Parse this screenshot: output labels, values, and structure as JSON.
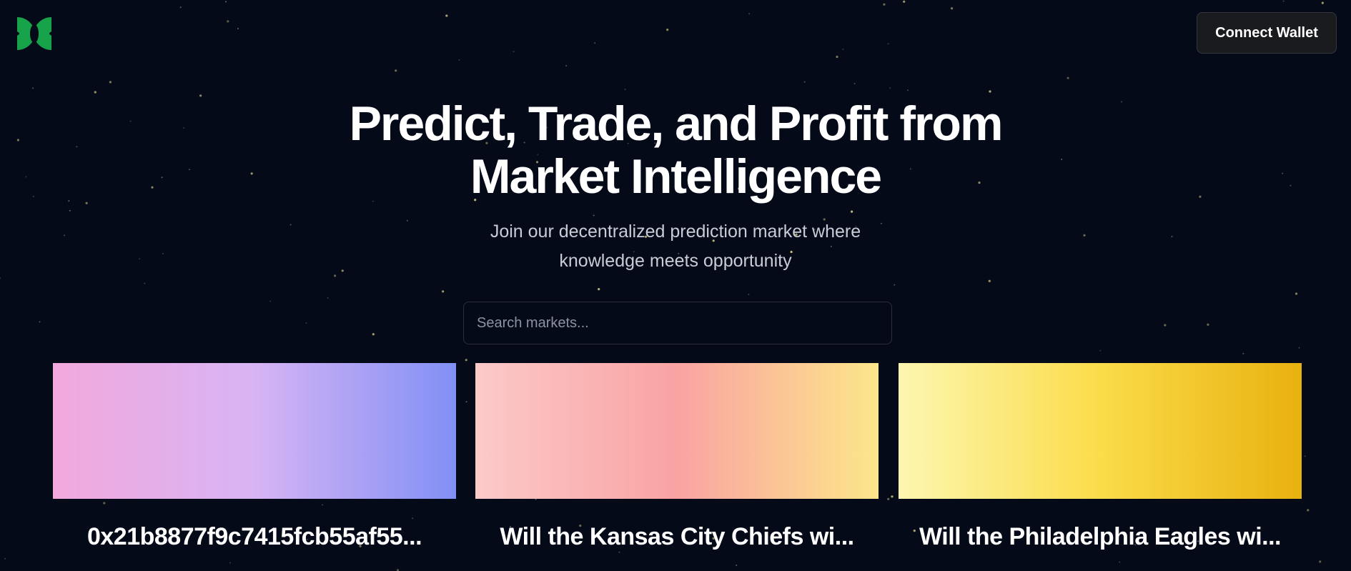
{
  "header": {
    "logo": "green-butterfly-logo",
    "connect_wallet_label": "Connect Wallet"
  },
  "hero": {
    "title_line1": "Predict, Trade, and Profit from",
    "title_line2": "Market Intelligence",
    "subtitle_line1": "Join our decentralized prediction market where",
    "subtitle_line2": "knowledge meets opportunity"
  },
  "search": {
    "placeholder": "Search markets..."
  },
  "markets": [
    {
      "title": "0x21b8877f9c7415fcb55af55...",
      "gradient": [
        "#f2a9dc",
        "#d7b4f4",
        "#8190f5"
      ]
    },
    {
      "title": "Will the Kansas City Chiefs wi...",
      "gradient": [
        "#fcc9c9",
        "#f9a3a3",
        "#fde68a"
      ]
    },
    {
      "title": "Will the Philadelphia Eagles wi...",
      "gradient": [
        "#fdf6b0",
        "#fbdc4a",
        "#e8b10f"
      ]
    }
  ],
  "colors": {
    "background": "#050a19",
    "logo_green": "#16a34a",
    "star": "#d8cf8a"
  }
}
